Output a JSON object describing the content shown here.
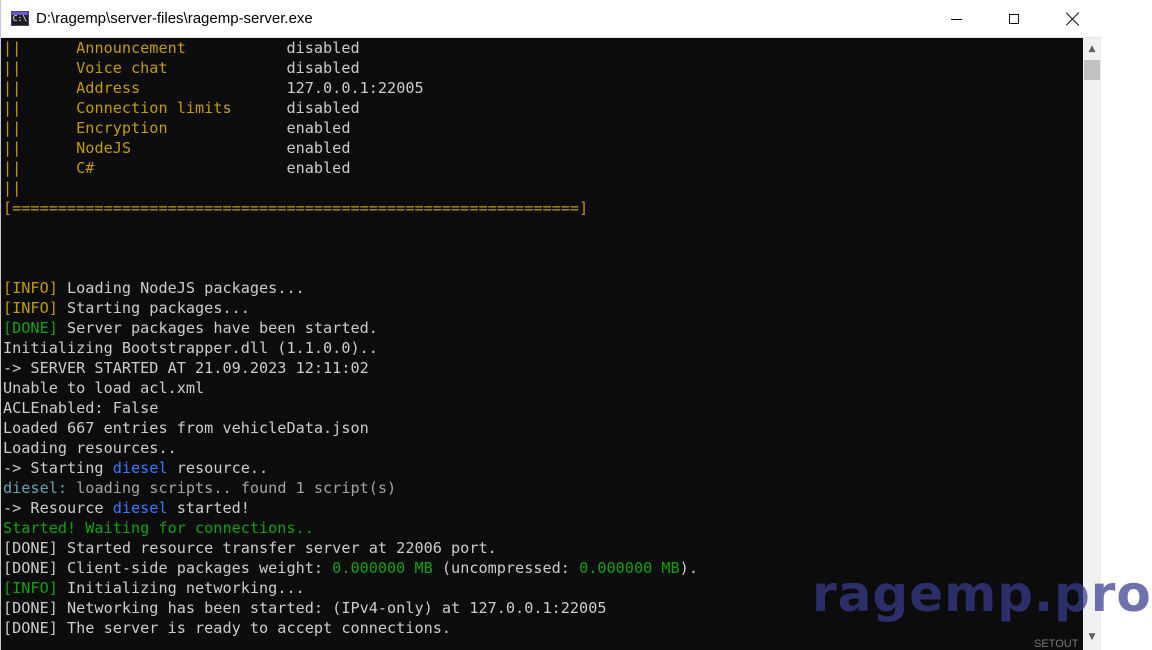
{
  "window": {
    "title": "D:\\ragemp\\server-files\\ragemp-server.exe",
    "app_icon_text": "C:\\"
  },
  "console": {
    "lines": [
      [
        {
          "t": "||      ",
          "c": "c-y"
        },
        {
          "t": "Announcement           ",
          "c": "c-y"
        },
        {
          "t": "disabled",
          "c": "c-w"
        }
      ],
      [
        {
          "t": "||      ",
          "c": "c-y"
        },
        {
          "t": "Voice chat             ",
          "c": "c-y"
        },
        {
          "t": "disabled",
          "c": "c-w"
        }
      ],
      [
        {
          "t": "||      ",
          "c": "c-y"
        },
        {
          "t": "Address                ",
          "c": "c-y"
        },
        {
          "t": "127.0.0.1:22005",
          "c": "c-w"
        }
      ],
      [
        {
          "t": "||      ",
          "c": "c-y"
        },
        {
          "t": "Connection limits      ",
          "c": "c-y"
        },
        {
          "t": "disabled",
          "c": "c-w"
        }
      ],
      [
        {
          "t": "||      ",
          "c": "c-y"
        },
        {
          "t": "Encryption             ",
          "c": "c-y"
        },
        {
          "t": "enabled",
          "c": "c-w"
        }
      ],
      [
        {
          "t": "||      ",
          "c": "c-y"
        },
        {
          "t": "NodeJS                 ",
          "c": "c-y"
        },
        {
          "t": "enabled",
          "c": "c-w"
        }
      ],
      [
        {
          "t": "||      ",
          "c": "c-y"
        },
        {
          "t": "C#                     ",
          "c": "c-y"
        },
        {
          "t": "enabled",
          "c": "c-w"
        }
      ],
      [
        {
          "t": "||",
          "c": "c-y"
        }
      ],
      [
        {
          "t": "[==============================================================]",
          "c": "c-y"
        }
      ],
      [],
      [],
      [],
      [
        {
          "t": "[INFO]",
          "c": "c-y"
        },
        {
          "t": " Loading NodeJS packages...",
          "c": "c-w"
        }
      ],
      [
        {
          "t": "[INFO]",
          "c": "c-y"
        },
        {
          "t": " Starting packages...",
          "c": "c-w"
        }
      ],
      [
        {
          "t": "[DONE]",
          "c": "c-g"
        },
        {
          "t": " Server packages have been started.",
          "c": "c-w"
        }
      ],
      [
        {
          "t": "Initializing Bootstrapper.dll (1.1.0.0)..",
          "c": "c-w"
        }
      ],
      [
        {
          "t": "-> SERVER STARTED AT 21.09.2023 12:11:02",
          "c": "c-w"
        }
      ],
      [
        {
          "t": "Unable to load acl.xml",
          "c": "c-w"
        }
      ],
      [
        {
          "t": "ACLEnabled: False",
          "c": "c-w"
        }
      ],
      [
        {
          "t": "Loaded 667 entries from vehicleData.json",
          "c": "c-w"
        }
      ],
      [
        {
          "t": "Loading resources..",
          "c": "c-w"
        }
      ],
      [
        {
          "t": "-> Starting ",
          "c": "c-w"
        },
        {
          "t": "diesel",
          "c": "c-b"
        },
        {
          "t": " resource..",
          "c": "c-w"
        }
      ],
      [
        {
          "t": "diesel:",
          "c": "c-cy"
        },
        {
          "t": " loading scripts.. found 1 script(s)",
          "c": "c-gr"
        }
      ],
      [
        {
          "t": "-> Resource ",
          "c": "c-w"
        },
        {
          "t": "diesel",
          "c": "c-b"
        },
        {
          "t": " started!",
          "c": "c-w"
        }
      ],
      [
        {
          "t": "Started! Waiting for connections..",
          "c": "c-g"
        }
      ],
      [
        {
          "t": "[DONE] Started resource transfer server at 22006 port.",
          "c": "c-w"
        }
      ],
      [
        {
          "t": "[DONE] Client-side packages weight: ",
          "c": "c-w"
        },
        {
          "t": "0.000000 MB",
          "c": "c-g"
        },
        {
          "t": " (uncompressed: ",
          "c": "c-w"
        },
        {
          "t": "0.000000 MB",
          "c": "c-g"
        },
        {
          "t": ").",
          "c": "c-w"
        }
      ],
      [
        {
          "t": "[INFO]",
          "c": "c-g"
        },
        {
          "t": " Initializing networking...",
          "c": "c-w"
        }
      ],
      [
        {
          "t": "[DONE] Networking has been started: (IPv4-only) at 127.0.0.1:22005",
          "c": "c-w"
        }
      ],
      [
        {
          "t": "[DONE] The server is ready to accept connections.",
          "c": "c-w"
        }
      ]
    ]
  },
  "watermark": "ragemp.pro",
  "edge_text": "SETOUT",
  "icons": {
    "minimize": "minimize-icon",
    "maximize": "maximize-icon",
    "close": "close-icon",
    "scroll_up": "chevron-up-icon",
    "scroll_down": "chevron-down-icon"
  },
  "colors": {
    "console_bg": "#0c0c0c",
    "yellow": "#c19c00",
    "green": "#13a10e",
    "blue": "#3b78ff",
    "text": "#cccccc"
  }
}
